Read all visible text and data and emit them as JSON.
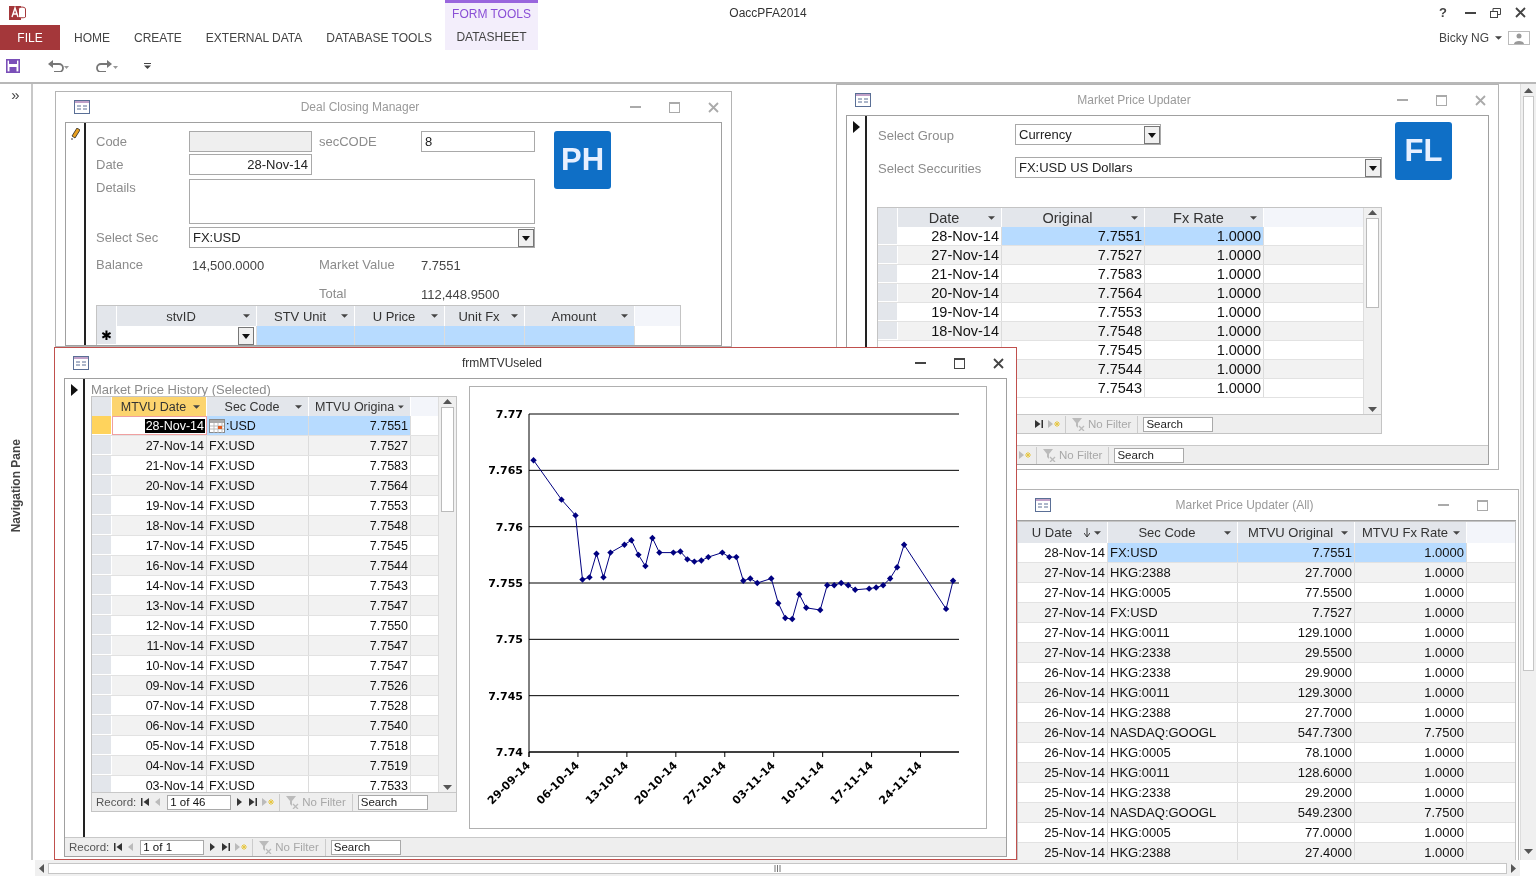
{
  "app": {
    "title": "OaccPFA2014",
    "help": "?",
    "user": "Bicky NG"
  },
  "ribbon": {
    "context_group": "FORM TOOLS",
    "tabs": [
      {
        "label": "FILE",
        "kind": "file",
        "selected": false
      },
      {
        "label": "HOME",
        "kind": "tab",
        "selected": false
      },
      {
        "label": "CREATE",
        "kind": "tab",
        "selected": false
      },
      {
        "label": "EXTERNAL DATA",
        "kind": "tab",
        "selected": false
      },
      {
        "label": "DATABASE TOOLS",
        "kind": "tab",
        "selected": false
      },
      {
        "label": "DATASHEET",
        "kind": "context",
        "selected": true
      }
    ]
  },
  "navigation_pane": {
    "toggle": "»",
    "label": "Navigation Pane"
  },
  "deal_closing_manager": {
    "title": "Deal Closing Manager",
    "active": false,
    "editing": true,
    "badge": "PH",
    "code": {
      "label": "Code",
      "disabled": true
    },
    "sec_code": {
      "label": "secCODE",
      "value": "8"
    },
    "date": {
      "label": "Date",
      "value": "28-Nov-14"
    },
    "details": {
      "label": "Details"
    },
    "select_sec": {
      "label": "Select Sec",
      "value": "FX:USD"
    },
    "balance": {
      "label": "Balance",
      "value": "14,500.0000"
    },
    "market_value": {
      "label": "Market Value",
      "value": "7.7551"
    },
    "total": {
      "label": "Total",
      "value": "112,448.9500"
    },
    "subform": {
      "new_row_mark": "✱",
      "columns": [
        {
          "label": "stvID"
        },
        {
          "label": "STV Unit"
        },
        {
          "label": "U Price"
        },
        {
          "label": "Unit Fx"
        },
        {
          "label": "Amount"
        }
      ]
    }
  },
  "market_price_updater": {
    "title": "Market Price Updater",
    "active": false,
    "editing": false,
    "badge": "FL",
    "select_group": {
      "label": "Select Group",
      "value": "Currency"
    },
    "select_securities": {
      "label": "Select Seccurities",
      "value": "FX:USD US Dollars"
    },
    "datasheet": {
      "focused": false,
      "columns": [
        {
          "label": "Date"
        },
        {
          "label": "Original"
        },
        {
          "label": "Fx Rate"
        }
      ],
      "rows": [
        {
          "date": "28-Nov-14",
          "original": "7.7551",
          "fx_rate": "1.0000",
          "selected": true
        },
        {
          "date": "27-Nov-14",
          "original": "7.7527",
          "fx_rate": "1.0000",
          "selected": false
        },
        {
          "date": "21-Nov-14",
          "original": "7.7583",
          "fx_rate": "1.0000",
          "selected": false
        },
        {
          "date": "20-Nov-14",
          "original": "7.7564",
          "fx_rate": "1.0000",
          "selected": false
        },
        {
          "date": "19-Nov-14",
          "original": "7.7553",
          "fx_rate": "1.0000",
          "selected": false
        },
        {
          "date": "18-Nov-14",
          "original": "7.7548",
          "fx_rate": "1.0000",
          "selected": false
        },
        {
          "original": "7.7545",
          "fx_rate": "1.0000",
          "selected": false
        },
        {
          "original": "7.7544",
          "fx_rate": "1.0000",
          "selected": false
        },
        {
          "original": "7.7543",
          "fx_rate": "1.0000",
          "selected": false
        }
      ],
      "navigator": {
        "no_filter": "No Filter",
        "search_placeholder": "Search"
      }
    },
    "navigator": {
      "no_filter": "No Filter",
      "search_placeholder": "Search"
    }
  },
  "frm_mtvu_useled": {
    "title": "frmMTVUseled",
    "active": true,
    "editing": false,
    "subform_label": "Market Price History (Selected)",
    "datasheet": {
      "focused": true,
      "columns": [
        {
          "label": "MTVU Date",
          "selected": true
        },
        {
          "label": "Sec Code",
          "selected": false
        },
        {
          "label": "MTVU Origina",
          "selected": false
        }
      ],
      "rows": [
        {
          "date": "28-Nov-14",
          "sec_code": ":USD",
          "original": "7.7551",
          "selected": true,
          "date_picker": true
        },
        {
          "date": "27-Nov-14",
          "sec_code": "FX:USD",
          "original": "7.7527",
          "selected": false,
          "date_picker": false
        },
        {
          "date": "21-Nov-14",
          "sec_code": "FX:USD",
          "original": "7.7583",
          "selected": false,
          "date_picker": false
        },
        {
          "date": "20-Nov-14",
          "sec_code": "FX:USD",
          "original": "7.7564",
          "selected": false,
          "date_picker": false
        },
        {
          "date": "19-Nov-14",
          "sec_code": "FX:USD",
          "original": "7.7553",
          "selected": false,
          "date_picker": false
        },
        {
          "date": "18-Nov-14",
          "sec_code": "FX:USD",
          "original": "7.7548",
          "selected": false,
          "date_picker": false
        },
        {
          "date": "17-Nov-14",
          "sec_code": "FX:USD",
          "original": "7.7545",
          "selected": false,
          "date_picker": false
        },
        {
          "date": "16-Nov-14",
          "sec_code": "FX:USD",
          "original": "7.7544",
          "selected": false,
          "date_picker": false
        },
        {
          "date": "14-Nov-14",
          "sec_code": "FX:USD",
          "original": "7.7543",
          "selected": false,
          "date_picker": false
        },
        {
          "date": "13-Nov-14",
          "sec_code": "FX:USD",
          "original": "7.7547",
          "selected": false,
          "date_picker": false
        },
        {
          "date": "12-Nov-14",
          "sec_code": "FX:USD",
          "original": "7.7550",
          "selected": false,
          "date_picker": false
        },
        {
          "date": "11-Nov-14",
          "sec_code": "FX:USD",
          "original": "7.7547",
          "selected": false,
          "date_picker": false
        },
        {
          "date": "10-Nov-14",
          "sec_code": "FX:USD",
          "original": "7.7547",
          "selected": false,
          "date_picker": false
        },
        {
          "date": "09-Nov-14",
          "sec_code": "FX:USD",
          "original": "7.7526",
          "selected": false,
          "date_picker": false
        },
        {
          "date": "07-Nov-14",
          "sec_code": "FX:USD",
          "original": "7.7528",
          "selected": false,
          "date_picker": false
        },
        {
          "date": "06-Nov-14",
          "sec_code": "FX:USD",
          "original": "7.7540",
          "selected": false,
          "date_picker": false
        },
        {
          "date": "05-Nov-14",
          "sec_code": "FX:USD",
          "original": "7.7518",
          "selected": false,
          "date_picker": false
        },
        {
          "date": "04-Nov-14",
          "sec_code": "FX:USD",
          "original": "7.7519",
          "selected": false,
          "date_picker": false
        },
        {
          "date": "03-Nov-14",
          "sec_code": "FX:USD",
          "original": "7.7533",
          "selected": false,
          "date_picker": false
        }
      ],
      "navigator": {
        "record_label": "Record:",
        "counter": "1 of 46",
        "no_filter": "No Filter",
        "search_placeholder": "Search"
      }
    },
    "chart_data": {
      "type": "line",
      "grid": true,
      "ylim": [
        7.74,
        7.77
      ],
      "yticks": [
        7.74,
        7.745,
        7.75,
        7.755,
        7.76,
        7.765,
        7.77
      ],
      "categories": [
        "29-09-14",
        null,
        null,
        null,
        null,
        null,
        null,
        "06-10-14",
        null,
        null,
        null,
        null,
        null,
        null,
        "13-10-14",
        null,
        null,
        null,
        null,
        null,
        null,
        "20-10-14",
        null,
        null,
        null,
        null,
        null,
        null,
        "27-10-14",
        null,
        null,
        null,
        null,
        null,
        null,
        "03-11-14",
        null,
        null,
        null,
        null,
        null,
        null,
        "10-11-14",
        null,
        null,
        null,
        null,
        null,
        null,
        "17-11-14",
        null,
        null,
        null,
        null,
        null,
        null,
        "24-11-14",
        null,
        null,
        null,
        null,
        null
      ],
      "series": [
        {
          "color": "#000080",
          "marker": "diamond",
          "values": [
            null,
            7.7659,
            null,
            null,
            null,
            7.7624,
            null,
            7.761,
            7.7553,
            7.7555,
            7.7576,
            7.7555,
            7.7577,
            null,
            7.7584,
            7.7588,
            7.7575,
            7.7565,
            7.759,
            7.7577,
            null,
            7.7577,
            7.7578,
            7.7571,
            7.7569,
            7.757,
            7.7573,
            null,
            7.7577,
            7.7573,
            7.7573,
            7.7552,
            7.7554,
            7.755,
            null,
            7.7554,
            7.7532,
            7.7519,
            7.7518,
            7.754,
            7.7528,
            null,
            7.7526,
            7.7548,
            7.7548,
            7.755,
            7.7548,
            7.7544,
            null,
            7.7545,
            7.7546,
            7.7548,
            7.7554,
            7.7564,
            7.7584,
            null,
            null,
            null,
            null,
            null,
            7.7527,
            7.7552
          ]
        }
      ]
    },
    "navigator": {
      "record_label": "Record:",
      "counter": "1 of 1",
      "no_filter": "No Filter",
      "search_placeholder": "Search"
    }
  },
  "market_price_updater_all": {
    "title": "Market Price Updater (All)",
    "active": false,
    "datasheet": {
      "columns": [
        {
          "label": "U Date",
          "sorted": true
        },
        {
          "label": "Sec Code",
          "sorted": false
        },
        {
          "label": "MTVU Original",
          "sorted": false
        },
        {
          "label": "MTVU Fx Rate",
          "sorted": false
        }
      ],
      "rows": [
        {
          "date": "28-Nov-14",
          "sec_code": "FX:USD",
          "original": "7.7551",
          "fx_rate": "1.0000",
          "selected": true
        },
        {
          "date": "27-Nov-14",
          "sec_code": "HKG:2388",
          "original": "27.7000",
          "fx_rate": "1.0000",
          "selected": false
        },
        {
          "date": "27-Nov-14",
          "sec_code": "HKG:0005",
          "original": "77.5500",
          "fx_rate": "1.0000",
          "selected": false
        },
        {
          "date": "27-Nov-14",
          "sec_code": "FX:USD",
          "original": "7.7527",
          "fx_rate": "1.0000",
          "selected": false
        },
        {
          "date": "27-Nov-14",
          "sec_code": "HKG:0011",
          "original": "129.1000",
          "fx_rate": "1.0000",
          "selected": false
        },
        {
          "date": "27-Nov-14",
          "sec_code": "HKG:2338",
          "original": "29.5500",
          "fx_rate": "1.0000",
          "selected": false
        },
        {
          "date": "26-Nov-14",
          "sec_code": "HKG:2338",
          "original": "29.9000",
          "fx_rate": "1.0000",
          "selected": false
        },
        {
          "date": "26-Nov-14",
          "sec_code": "HKG:0011",
          "original": "129.3000",
          "fx_rate": "1.0000",
          "selected": false
        },
        {
          "date": "26-Nov-14",
          "sec_code": "HKG:2388",
          "original": "27.7000",
          "fx_rate": "1.0000",
          "selected": false
        },
        {
          "date": "26-Nov-14",
          "sec_code": "NASDAQ:GOOGL",
          "original": "547.7300",
          "fx_rate": "7.7500",
          "selected": false
        },
        {
          "date": "26-Nov-14",
          "sec_code": "HKG:0005",
          "original": "78.1000",
          "fx_rate": "1.0000",
          "selected": false
        },
        {
          "date": "25-Nov-14",
          "sec_code": "HKG:0011",
          "original": "128.6000",
          "fx_rate": "1.0000",
          "selected": false
        },
        {
          "date": "25-Nov-14",
          "sec_code": "HKG:2338",
          "original": "29.2000",
          "fx_rate": "1.0000",
          "selected": false
        },
        {
          "date": "25-Nov-14",
          "sec_code": "NASDAQ:GOOGL",
          "original": "549.2300",
          "fx_rate": "7.7500",
          "selected": false
        },
        {
          "date": "25-Nov-14",
          "sec_code": "HKG:0005",
          "original": "77.0000",
          "fx_rate": "1.0000",
          "selected": false
        },
        {
          "date": "25-Nov-14",
          "sec_code": "HKG:2388",
          "original": "27.4000",
          "fx_rate": "1.0000",
          "selected": false
        }
      ]
    }
  }
}
